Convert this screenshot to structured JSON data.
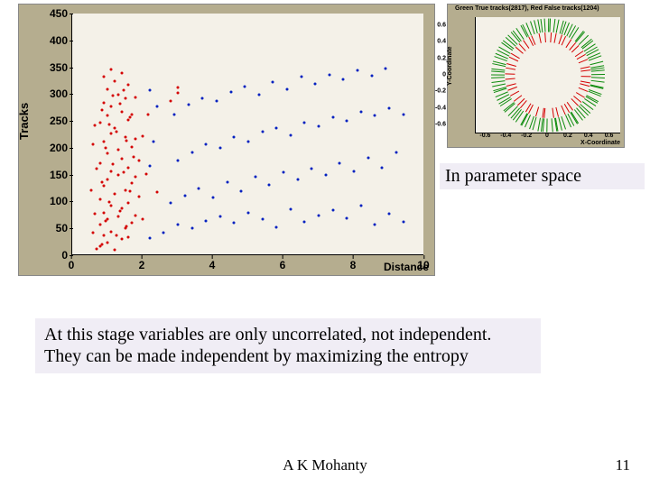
{
  "scatter": {
    "ylabel": "Tracks",
    "xlabel": "Distance",
    "xlim": [
      0,
      10
    ],
    "ylim": [
      0,
      450
    ],
    "xticks": [
      0,
      2,
      4,
      6,
      8,
      10
    ],
    "yticks": [
      0,
      50,
      100,
      150,
      200,
      250,
      300,
      350,
      400,
      450
    ]
  },
  "inset": {
    "title": "Green True tracks(2817), Red False tracks(1204)",
    "ylabel": "Y-Coordinate",
    "xlabel": "X-Coordinate",
    "xlim": [
      -0.7,
      0.7
    ],
    "ylim": [
      -0.7,
      0.7
    ],
    "xticks": [
      -0.6,
      -0.4,
      -0.2,
      0,
      0.2,
      0.4,
      0.6
    ],
    "yticks": [
      -0.6,
      -0.4,
      -0.2,
      0,
      0.2,
      0.4,
      0.6
    ]
  },
  "callouts": {
    "param": "In parameter space",
    "main": "At this stage variables are only uncorrelated, not independent. They can be made independent by maximizing the entropy"
  },
  "footer": {
    "author": "A K Mohanty",
    "page": "11"
  },
  "chart_data": [
    {
      "type": "scatter",
      "title": "",
      "xlabel": "Distance",
      "ylabel": "Tracks",
      "xlim": [
        0,
        10
      ],
      "ylim": [
        0,
        450
      ],
      "series": [
        {
          "name": "red",
          "color": "#d40000",
          "points": [
            [
              0.7,
              10
            ],
            [
              0.8,
              15
            ],
            [
              1.2,
              8
            ],
            [
              1.0,
              22
            ],
            [
              1.4,
              28
            ],
            [
              0.9,
              35
            ],
            [
              1.6,
              32
            ],
            [
              1.1,
              42
            ],
            [
              1.5,
              48
            ],
            [
              0.8,
              55
            ],
            [
              1.7,
              58
            ],
            [
              1.0,
              65
            ],
            [
              1.3,
              70
            ],
            [
              1.8,
              72
            ],
            [
              0.9,
              78
            ],
            [
              1.4,
              85
            ],
            [
              1.1,
              90
            ],
            [
              1.6,
              95
            ],
            [
              0.8,
              102
            ],
            [
              1.9,
              108
            ],
            [
              1.2,
              112
            ],
            [
              1.5,
              120
            ],
            [
              0.9,
              128
            ],
            [
              1.7,
              132
            ],
            [
              1.0,
              140
            ],
            [
              1.3,
              148
            ],
            [
              1.8,
              145
            ],
            [
              1.1,
              155
            ],
            [
              1.6,
              162
            ],
            [
              0.8,
              170
            ],
            [
              1.4,
              178
            ],
            [
              1.9,
              175
            ],
            [
              1.0,
              188
            ],
            [
              1.3,
              195
            ],
            [
              1.7,
              200
            ],
            [
              0.9,
              210
            ],
            [
              1.5,
              218
            ],
            [
              1.1,
              225
            ],
            [
              1.8,
              215
            ],
            [
              1.2,
              235
            ],
            [
              0.8,
              245
            ],
            [
              1.6,
              250
            ],
            [
              1.0,
              258
            ],
            [
              1.4,
              265
            ],
            [
              1.7,
              260
            ],
            [
              1.1,
              275
            ],
            [
              0.9,
              282
            ],
            [
              1.5,
              290
            ],
            [
              1.3,
              298
            ],
            [
              1.8,
              292
            ],
            [
              1.0,
              308
            ],
            [
              1.6,
              315
            ],
            [
              1.2,
              322
            ],
            [
              0.9,
              330
            ],
            [
              1.4,
              338
            ],
            [
              1.1,
              345
            ],
            [
              3.0,
              310
            ],
            [
              2.4,
              116
            ],
            [
              2.8,
              285
            ],
            [
              3.0,
              300
            ],
            [
              0.85,
              18
            ],
            [
              1.25,
              36
            ],
            [
              1.55,
              52
            ],
            [
              0.95,
              62
            ],
            [
              1.35,
              80
            ],
            [
              1.05,
              98
            ],
            [
              1.65,
              118
            ],
            [
              0.85,
              135
            ],
            [
              1.45,
              152
            ],
            [
              1.15,
              168
            ],
            [
              1.75,
              182
            ],
            [
              0.95,
              198
            ],
            [
              1.55,
              212
            ],
            [
              1.25,
              228
            ],
            [
              1.05,
              242
            ],
            [
              1.65,
              255
            ],
            [
              0.85,
              268
            ],
            [
              1.35,
              280
            ],
            [
              1.15,
              295
            ],
            [
              1.45,
              305
            ],
            [
              0.6,
              40
            ],
            [
              0.65,
              75
            ],
            [
              0.55,
              120
            ],
            [
              0.7,
              160
            ],
            [
              0.6,
              205
            ],
            [
              0.65,
              240
            ],
            [
              2.0,
              65
            ],
            [
              2.1,
              150
            ],
            [
              2.0,
              220
            ],
            [
              2.15,
              260
            ]
          ]
        },
        {
          "name": "blue",
          "color": "#0020c0",
          "points": [
            [
              2.6,
              40
            ],
            [
              3.0,
              55
            ],
            [
              3.4,
              48
            ],
            [
              3.8,
              62
            ],
            [
              4.2,
              70
            ],
            [
              4.6,
              58
            ],
            [
              5.0,
              78
            ],
            [
              5.4,
              65
            ],
            [
              5.8,
              50
            ],
            [
              6.2,
              84
            ],
            [
              6.6,
              60
            ],
            [
              7.0,
              72
            ],
            [
              7.4,
              82
            ],
            [
              7.8,
              68
            ],
            [
              8.2,
              90
            ],
            [
              8.6,
              55
            ],
            [
              9.0,
              76
            ],
            [
              9.4,
              60
            ],
            [
              2.8,
              95
            ],
            [
              3.2,
              110
            ],
            [
              3.6,
              122
            ],
            [
              4.0,
              105
            ],
            [
              4.4,
              135
            ],
            [
              4.8,
              118
            ],
            [
              5.2,
              145
            ],
            [
              5.6,
              130
            ],
            [
              6.0,
              152
            ],
            [
              6.4,
              140
            ],
            [
              6.8,
              160
            ],
            [
              7.2,
              148
            ],
            [
              7.6,
              170
            ],
            [
              8.0,
              155
            ],
            [
              8.4,
              180
            ],
            [
              8.8,
              162
            ],
            [
              9.2,
              190
            ],
            [
              3.0,
              175
            ],
            [
              3.4,
              190
            ],
            [
              3.8,
              205
            ],
            [
              4.2,
              198
            ],
            [
              4.6,
              218
            ],
            [
              5.0,
              210
            ],
            [
              5.4,
              228
            ],
            [
              5.8,
              235
            ],
            [
              6.2,
              222
            ],
            [
              6.6,
              245
            ],
            [
              7.0,
              238
            ],
            [
              7.4,
              255
            ],
            [
              7.8,
              248
            ],
            [
              8.2,
              265
            ],
            [
              8.6,
              258
            ],
            [
              9.0,
              272
            ],
            [
              9.4,
              260
            ],
            [
              2.9,
              260
            ],
            [
              3.3,
              278
            ],
            [
              3.7,
              290
            ],
            [
              4.1,
              285
            ],
            [
              4.5,
              302
            ],
            [
              4.9,
              312
            ],
            [
              5.3,
              298
            ],
            [
              5.7,
              320
            ],
            [
              6.1,
              308
            ],
            [
              6.5,
              330
            ],
            [
              6.9,
              318
            ],
            [
              7.3,
              335
            ],
            [
              7.7,
              325
            ],
            [
              8.1,
              342
            ],
            [
              8.5,
              332
            ],
            [
              8.9,
              346
            ],
            [
              2.2,
              30
            ],
            [
              2.2,
              165
            ],
            [
              2.3,
              210
            ],
            [
              2.4,
              275
            ],
            [
              2.2,
              305
            ]
          ]
        }
      ]
    },
    {
      "type": "scatter",
      "title": "Green True tracks(2817), Red False tracks(1204)",
      "xlabel": "X-Coordinate",
      "ylabel": "Y-Coordinate",
      "xlim": [
        -0.7,
        0.7
      ],
      "ylim": [
        -0.7,
        0.7
      ],
      "note": "Ring/annulus of points ~radius 0.35–0.55; green outer band (2817 pts), red inner band (1204 pts)",
      "series": [
        {
          "name": "Green True tracks",
          "n": 2817,
          "color": "#0a8a0a"
        },
        {
          "name": "Red False tracks",
          "n": 1204,
          "color": "#d40000"
        }
      ]
    }
  ]
}
